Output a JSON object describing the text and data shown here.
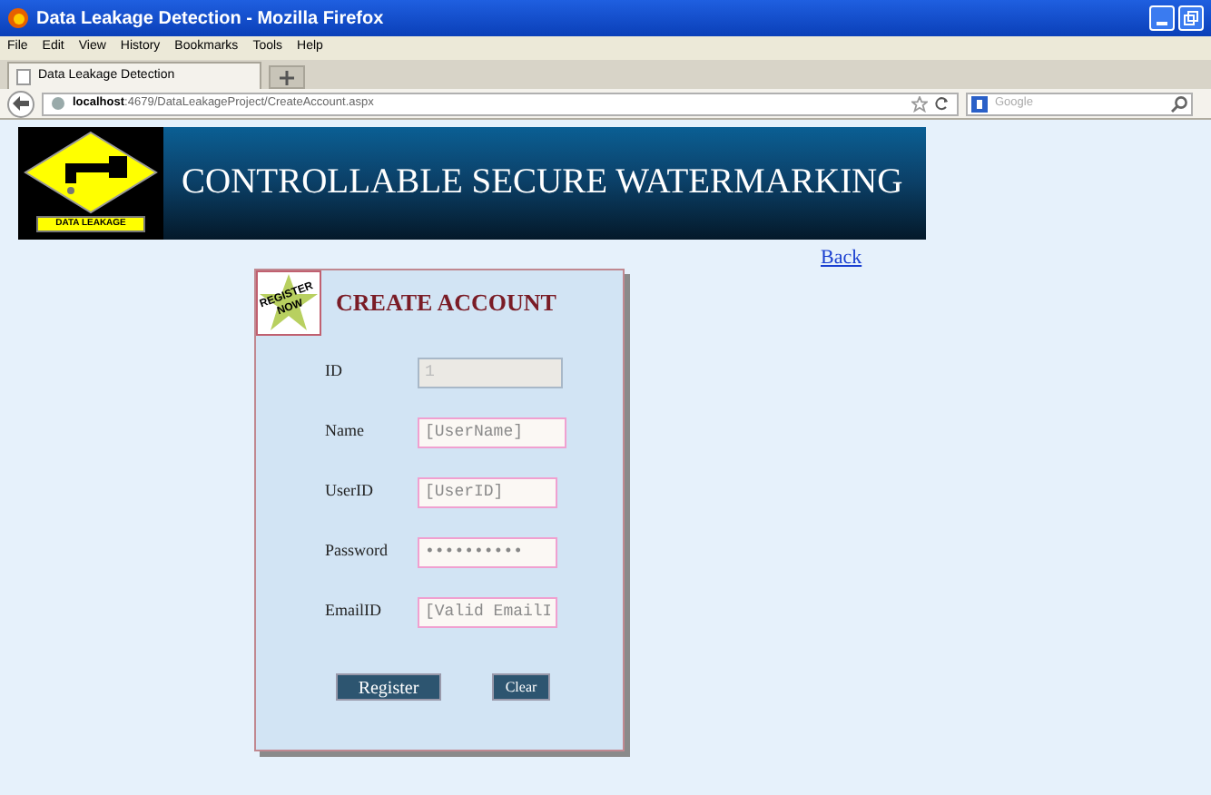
{
  "window": {
    "title": "Data Leakage Detection - Mozilla Firefox"
  },
  "menu": [
    "File",
    "Edit",
    "View",
    "History",
    "Bookmarks",
    "Tools",
    "Help"
  ],
  "tabs": [
    {
      "label": "Data Leakage Detection",
      "selected": true
    }
  ],
  "address": {
    "host": "localhost",
    "path": ":4679/DataLeakageProject/CreateAccount.aspx"
  },
  "search": {
    "placeholder": "Google"
  },
  "banner": {
    "logo_label": "DATA LEAKAGE",
    "title": "CONTROLLABLE SECURE WATERMARKING"
  },
  "back_link": "Back",
  "form": {
    "badge": "REGISTER NOW",
    "title": "CREATE ACCOUNT",
    "fields": [
      {
        "label": "ID",
        "value": "1",
        "disabled": true
      },
      {
        "label": "Name",
        "placeholder": "[UserName]",
        "disabled": false
      },
      {
        "label": "UserID",
        "placeholder": "[UserID]",
        "disabled": false
      },
      {
        "label": "Password",
        "value": "••••••••••",
        "disabled": false
      },
      {
        "label": "EmailID",
        "placeholder": "[Valid EmailI",
        "disabled": false
      }
    ],
    "buttons": [
      "Register",
      "Clear"
    ]
  }
}
